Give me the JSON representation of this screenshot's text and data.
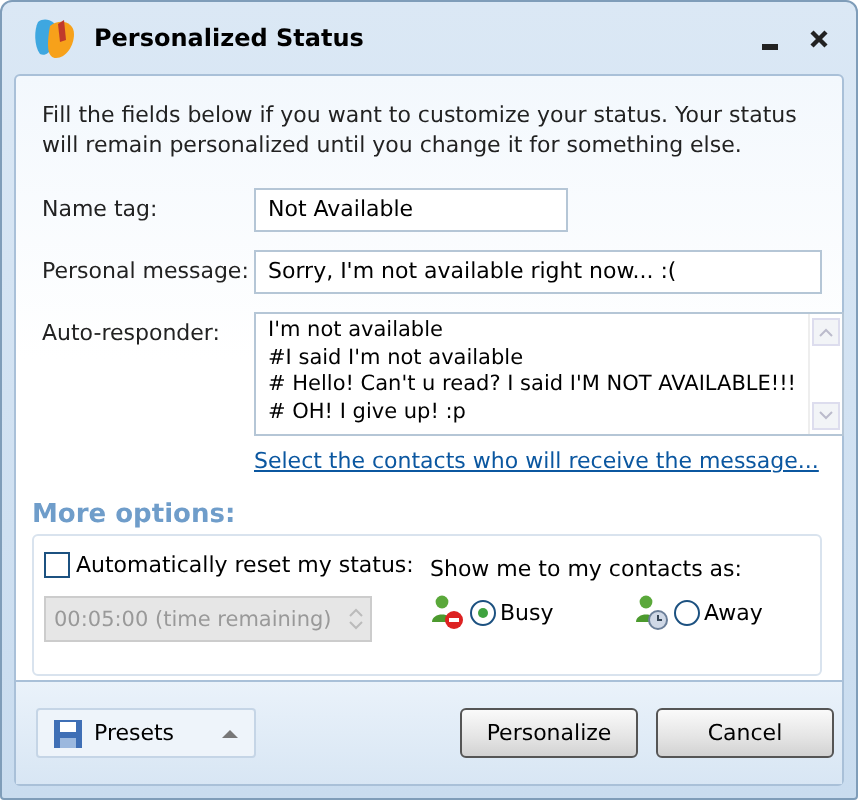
{
  "window": {
    "title": "Personalized Status"
  },
  "intro": "Fill the fields below if you want to customize your status. Your status will remain personalized until you change it for something else.",
  "fields": [
    {
      "label": "Name tag:",
      "value": "Not Available",
      "kind": "short"
    },
    {
      "label": "Personal message:",
      "value": "Sorry, I'm not available right now... :(",
      "kind": "long"
    }
  ],
  "auto_responder": {
    "label": "Auto-responder:",
    "lines": [
      "I'm not available",
      "#I said I'm not available",
      "# Hello! Can't u read? I said I'M NOT AVAILABLE!!!",
      "# OH! I give up! :p"
    ]
  },
  "contacts_link": "Select the contacts who will receive the message...",
  "more_options": {
    "title": "More options:",
    "reset": {
      "label": "Automatically reset my status:",
      "checked": false
    },
    "timer": {
      "value": "00:05:00 (time remaining)",
      "disabled": true
    },
    "show_as": {
      "label": "Show me to my contacts as:",
      "options": [
        {
          "label": "Busy",
          "selected": true,
          "kind": "busy"
        },
        {
          "label": "Away",
          "selected": false,
          "kind": "away"
        }
      ]
    }
  },
  "buttons": [
    {
      "label": "Presets",
      "kind": "menu"
    },
    {
      "label": "Personalize",
      "kind": "push"
    },
    {
      "label": "Cancel",
      "kind": "push"
    }
  ]
}
